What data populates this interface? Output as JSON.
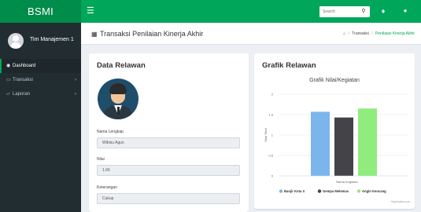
{
  "header": {
    "brand": "BSMI",
    "search_placeholder": "Search"
  },
  "sidebar": {
    "user_name": "Tim Manajemen 1",
    "items": [
      {
        "label": "Dashboard",
        "icon": "dashboard-icon",
        "active": true
      },
      {
        "label": "Transaksi",
        "icon": "laptop-icon",
        "has_arrow": true
      },
      {
        "label": "Laporan",
        "icon": "folder-open-icon",
        "has_arrow": true
      }
    ]
  },
  "content_header": {
    "title": "Transaksi Penilaian Kinerja Akhir",
    "breadcrumb": [
      "Transaksi",
      "Penilaian Kinerja Akhir"
    ]
  },
  "relawan": {
    "title": "Data Relawan",
    "fields": [
      {
        "label": "Nama Lengkap",
        "value": "Wibisu Agun"
      },
      {
        "label": "Nilai",
        "value": "1.66"
      },
      {
        "label": "Keterangan",
        "value": "Cukup"
      }
    ]
  },
  "grafik": {
    "title": "Grafik Relawan",
    "footer": "Highcharts.com"
  },
  "chart_data": {
    "type": "bar",
    "title": "Grafik Nilai/Kegiatan",
    "xlabel": "Nama Kegiatan",
    "ylabel": "Nilai Total",
    "ylim": [
      0,
      2
    ],
    "yticks": [
      0,
      0.5,
      1,
      1.5,
      2
    ],
    "series": [
      {
        "name": "Banjir Kota X",
        "value": 1.57,
        "color": "#7cb5ec"
      },
      {
        "name": "Gempa Melemas",
        "value": 1.43,
        "color": "#434348"
      },
      {
        "name": "Angin Kencang",
        "value": 1.65,
        "color": "#90ed7d"
      }
    ]
  }
}
